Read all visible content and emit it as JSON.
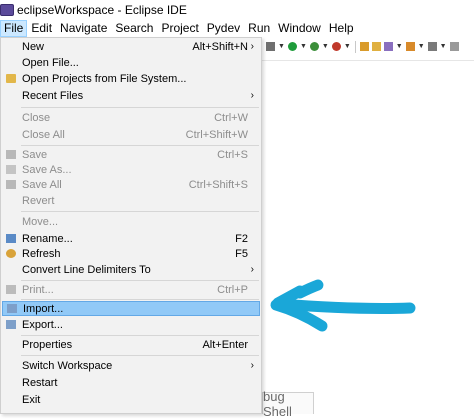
{
  "window": {
    "title": "eclipseWorkspace - Eclipse IDE"
  },
  "menubar": [
    "File",
    "Edit",
    "Navigate",
    "Search",
    "Project",
    "Pydev",
    "Run",
    "Window",
    "Help"
  ],
  "file_menu": {
    "new": {
      "label": "New",
      "shortcut": "Alt+Shift+N"
    },
    "open_file": {
      "label": "Open File..."
    },
    "open_projects": {
      "label": "Open Projects from File System..."
    },
    "recent_files": {
      "label": "Recent Files"
    },
    "close": {
      "label": "Close",
      "shortcut": "Ctrl+W"
    },
    "close_all": {
      "label": "Close All",
      "shortcut": "Ctrl+Shift+W"
    },
    "save": {
      "label": "Save",
      "shortcut": "Ctrl+S"
    },
    "save_as": {
      "label": "Save As..."
    },
    "save_all": {
      "label": "Save All",
      "shortcut": "Ctrl+Shift+S"
    },
    "revert": {
      "label": "Revert"
    },
    "move": {
      "label": "Move..."
    },
    "rename": {
      "label": "Rename...",
      "shortcut": "F2"
    },
    "refresh": {
      "label": "Refresh",
      "shortcut": "F5"
    },
    "convert": {
      "label": "Convert Line Delimiters To"
    },
    "print": {
      "label": "Print...",
      "shortcut": "Ctrl+P"
    },
    "import": {
      "label": "Import..."
    },
    "export": {
      "label": "Export..."
    },
    "properties": {
      "label": "Properties",
      "shortcut": "Alt+Enter"
    },
    "switch_workspace": {
      "label": "Switch Workspace"
    },
    "restart": {
      "label": "Restart"
    },
    "exit": {
      "label": "Exit"
    }
  },
  "background": {
    "debug_shell_label": "bug Shell"
  },
  "icons": {
    "app": "eclipse-icon",
    "open_projects": "folder-icon",
    "save": "save-icon",
    "save_as": "save-as-icon",
    "save_all": "save-all-icon",
    "rename": "rename-icon",
    "refresh": "refresh-icon",
    "print": "print-icon",
    "import": "import-icon",
    "export": "export-icon"
  },
  "colors": {
    "highlight": "#91c9f7",
    "menu_bg": "#f2f2f2",
    "arrow": "#1aa7d8",
    "disabled_text": "#8d8d8d"
  }
}
